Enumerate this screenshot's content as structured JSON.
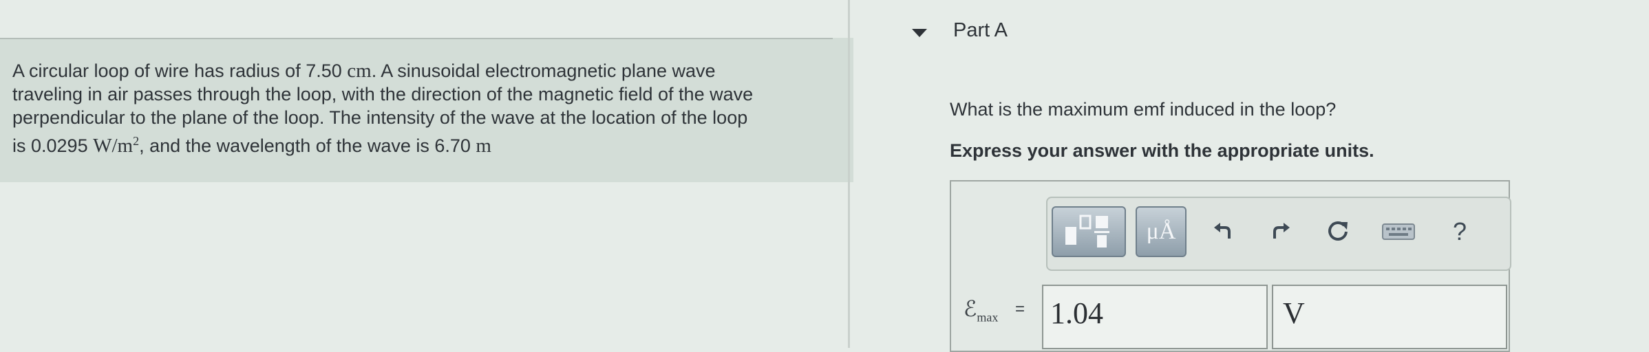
{
  "problem": {
    "line1_a": "A circular loop of wire has radius of 7.50 ",
    "line1_unit": "cm",
    "line1_b": ". A sinusoidal electromagnetic plane wave",
    "line2": "traveling in air passes through the loop, with the direction of the magnetic field of the wave",
    "line3": "perpendicular to the plane of the loop. The intensity of the wave at the location of the loop",
    "line4_a": "is 0.0295 ",
    "line4_unit": "W/m",
    "line4_exp": "2",
    "line4_b": ", and the wavelength of the wave is 6.70 ",
    "line4_unit2": "m"
  },
  "part": {
    "title": "Part A",
    "question": "What is the maximum emf induced in the loop?",
    "instruction": "Express your answer with the appropriate units."
  },
  "toolbar": {
    "units_label": "μÅ",
    "help_label": "?",
    "icons": [
      "templates-icon",
      "units-icon",
      "undo-icon",
      "redo-icon",
      "reset-icon",
      "keyboard-icon",
      "help-icon"
    ]
  },
  "answer": {
    "symbol": "ℰ",
    "subscript": "max",
    "equals": "=",
    "value": "1.04",
    "unit": "V"
  },
  "colors": {
    "background": "#e6ece8",
    "problem_background": "#d3ddd7",
    "text": "#2e3338"
  }
}
